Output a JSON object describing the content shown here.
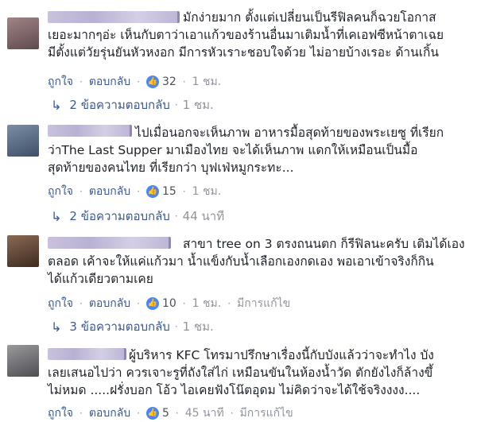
{
  "comments": [
    {
      "text": "มักง่ายมาก ตั้งแต่เปลี่ยนเป็นรีฟิลคนก็ฉวยโอกาส\nเยอะมากๆอ่ะ เห็นกับตาว่าเอาแก้วของร้านอื่นมาเติมน้ำที่เคเอฟซีหน้าตาเฉย\nมีตั้งแต่วัยรุ่นยันหัวหงอก มีการหัวเราะชอบใจด้วย ไม่อายบ้างเรอะ ด้านเกิ้น",
      "like_label": "ถูกใจ",
      "reply_label": "ตอบกลับ",
      "like_count": "32",
      "time": "1 ชม.",
      "replies_label": "2 ข้อความตอบกลับ",
      "replies_time": "1 ชม.",
      "avatar_color": "#8a6f73"
    },
    {
      "text": "ไปเมื่อนอกจะเห็นภาพ อาหารมื้อสุดท้ายของพระเยซู ที่เรียก\nว่าThe Last Supper มาเมืองไทย จะได้เห็นภาพ แดกให้เหมือนเป็นมื้อ\nสุดท้ายของคนไทย ที่เรียกว่า บุฟเฟ่หมูกระทะ...",
      "like_label": "ถูกใจ",
      "reply_label": "ตอบกลับ",
      "like_count": "15",
      "time": "1 ชม.",
      "replies_label": "2 ข้อความตอบกลับ",
      "replies_time": "44 นาที",
      "avatar_color": "#5a6e86"
    },
    {
      "text": "สาขา tree on 3 ตรงถนนตก ก็รีฟิลนะครับ เติมได้เอง\nตลอด เค้าจะให้แค่แก้วมา น้ำแข็งกับน้ำเลือกเองกดเอง พอเอาเข้าจริงก็กิน\nได้แก้วเดียวตามเคย",
      "like_label": "ถูกใจ",
      "reply_label": "ตอบกลับ",
      "like_count": "10",
      "time": "1 ชม.",
      "edited": "มีการแก้ไข",
      "replies_label": "3 ข้อความตอบกลับ",
      "replies_time": "1 ชม.",
      "avatar_color": "#6b4e3a"
    },
    {
      "text": "ผู้บริหาร KFC โทรมาปรึกษาเรื่องนี้กับบังแล้วว่าจะทำไง บัง\nเลยเสนอไปว่า ควรเจาะรูที่ถังใส่ไก่ เหมือนขันในห้องน้ำวัด ตักยังไงก็ล้างขึ้\nไม่หมด .....ฝรั่งบอก โอ้ว ไอเคยฟังโน๊ตอุดม ไม่คิดว่าจะได้ใช้จริงงงง....",
      "like_label": "ถูกใจ",
      "reply_label": "ตอบกลับ",
      "like_count": "5",
      "time": "45 นาที",
      "edited": "มีการแก้ไข",
      "avatar_color": "#7b7a7e"
    }
  ]
}
